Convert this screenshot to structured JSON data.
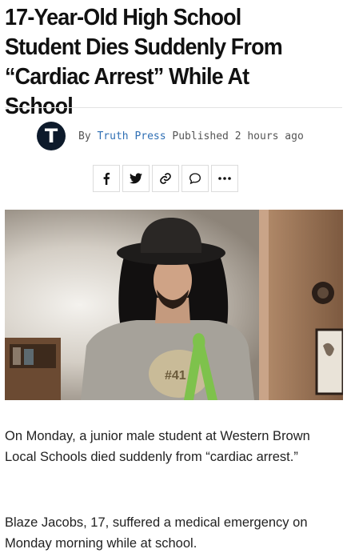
{
  "article": {
    "headline": "17-Year-Old High School Student Dies Suddenly From “Cardiac Arrest” While At School",
    "avatar_letter": "T",
    "byline_prefix": "By",
    "author": "Truth Press",
    "published_label": "Published",
    "published_time": "2 hours ago",
    "photo_shirt_text": "#41",
    "paragraphs": [
      "On Monday, a junior male student at Western Brown Local Schools died suddenly from “cardiac arrest.”",
      "Blaze Jacobs, 17, suffered a medical emergency on Monday morning while at school."
    ]
  },
  "share_buttons": [
    {
      "icon": "facebook-icon"
    },
    {
      "icon": "twitter-icon"
    },
    {
      "icon": "link-icon"
    },
    {
      "icon": "comment-icon"
    },
    {
      "icon": "more-icon"
    }
  ]
}
